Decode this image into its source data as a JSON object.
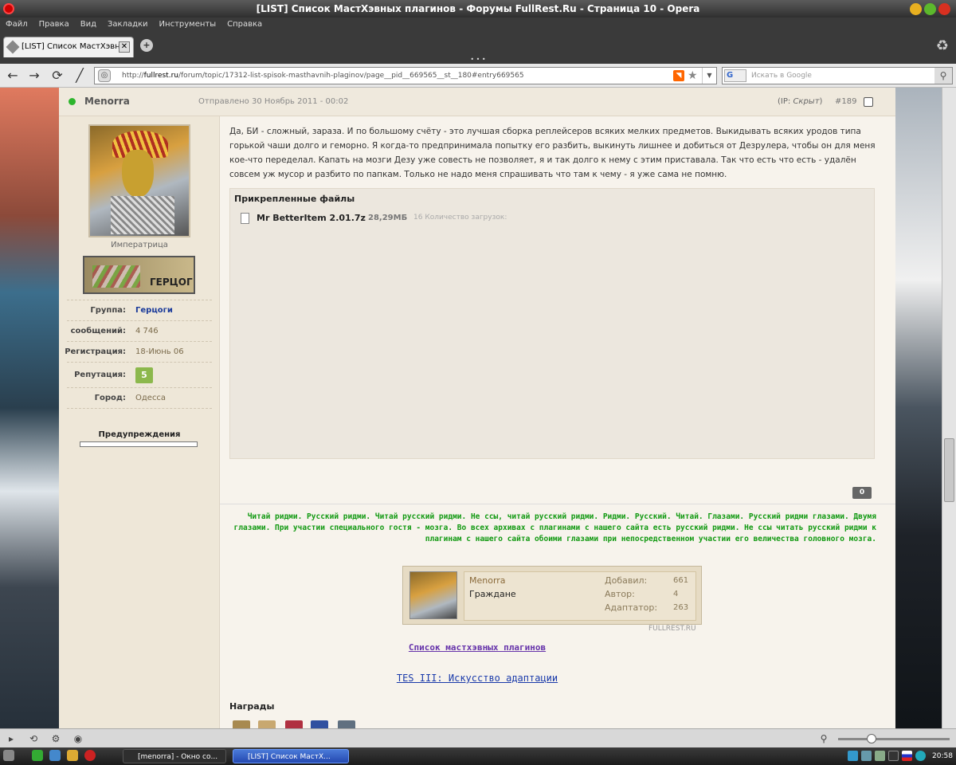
{
  "window": {
    "title": "[LIST] Список МастХэвных плагинов - Форумы FullRest.Ru - Страница 10 - Opera"
  },
  "menu": [
    "Файл",
    "Правка",
    "Вид",
    "Закладки",
    "Инструменты",
    "Справка"
  ],
  "tab": {
    "label": "[LIST] Список МастХэвн...",
    "close": "✕"
  },
  "nav": {
    "url_prefix": "http://",
    "url_host": "fullrest.ru",
    "url_path": "/forum/topic/17312-list-spisok-masthavnih-plaginov/page__pid__669565__st__180#entry669565",
    "search_placeholder": "Искать в Google",
    "search_engine": "G"
  },
  "post": {
    "author": "Menorra",
    "posted": "Отправлено 30 Ноябрь 2011 - 00:02",
    "ip_label": "(IP: ",
    "ip_value": "Скрыт",
    "ip_close": ")",
    "number": "#189",
    "body": "Да, БИ - сложный, зараза. И по большому счёту - это лучшая сборка реплейсеров всяких мелких предметов. Выкидывать всяких уродов типа горькой чаши долго и геморно. Я когда-то предпринимала попытку его разбить, выкинуть лишнее и добиться от Дезрулера, чтобы он для меня кое-что переделал. Капать на мозги Дезу уже совесть не позволяет, я и так долго к нему с этим приставала. Так что есть что есть - удалён совсем уж мусор и разбито по папкам. Только не надо меня спрашивать что там к чему - я уже сама не помню.",
    "attachments_title": "Прикрепленные файлы",
    "file_name": "Mr BetterItem 2.01.7z",
    "file_size": "28,29МБ",
    "file_downloads": "16 Количество загрузок:",
    "rating": "0"
  },
  "profile": {
    "rank_title": "Императрица",
    "badge_text": "ГЕРЦОГ",
    "group_label": "Группа:",
    "group_value": "Герцоги",
    "posts_label": "сообщений:",
    "posts_value": "4 746",
    "reg_label": "Регистрация:",
    "reg_value": "18-Июнь 06",
    "rep_label": "Репутация:",
    "rep_value": "5",
    "city_label": "Город:",
    "city_value": "Одесса",
    "warnings_label": "Предупреждения"
  },
  "signature": {
    "text": "Читай ридми. Русский ридми. Читай русский ридми. Не ссы, читай русский ридми. Ридми. Русский. Читай. Глазами. Русский ридми глазами. Двумя глазами. При участии специального гостя - мозга. Во всех архивах с плагинами с нашего сайта есть русский ридми. Не ссы читать русский ридми к плагинам с нашего сайта обоими глазами при непосредственном участии его величества головного мозга.",
    "userbar_name": "Menorra",
    "userbar_group": "Граждане",
    "added_label": "Добавил:",
    "added_value": "661",
    "author_label": "Автор:",
    "author_value": "4",
    "adapter_label": "Адаптатор:",
    "adapter_value": "263",
    "userbar_site": "FULLREST.RU",
    "link1": "Список мастхэвных плагинов",
    "link2": "TES III: Искусство адаптации"
  },
  "awards_label": "Награды",
  "taskbar": {
    "task1": "[menorra] - Окно со...",
    "task2": "[LIST] Список МастХ...",
    "clock": "20:58"
  },
  "colors": {
    "online": "#2db52d",
    "signature": "#119911",
    "reputation": "#8cb84c"
  }
}
